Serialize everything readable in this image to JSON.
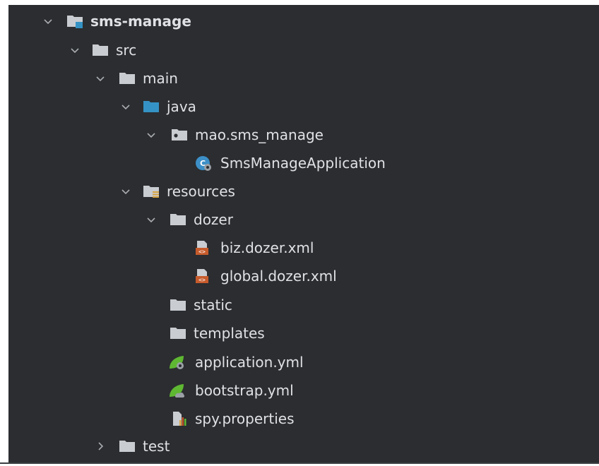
{
  "project_tree": {
    "root": {
      "label": "sms-manage"
    },
    "src": {
      "label": "src"
    },
    "main": {
      "label": "main"
    },
    "java": {
      "label": "java"
    },
    "package": {
      "label": "mao.sms_manage"
    },
    "app_class": {
      "label": "SmsManageApplication"
    },
    "resources": {
      "label": "resources"
    },
    "dozer": {
      "label": "dozer"
    },
    "biz_xml": {
      "label": "biz.dozer.xml"
    },
    "global_xml": {
      "label": "global.dozer.xml"
    },
    "static": {
      "label": "static"
    },
    "templates": {
      "label": "templates"
    },
    "application_yml": {
      "label": "application.yml"
    },
    "bootstrap_yml": {
      "label": "bootstrap.yml"
    },
    "spy_properties": {
      "label": "spy.properties"
    },
    "test": {
      "label": "test"
    }
  },
  "colors": {
    "background": "#2b2d30",
    "text": "#dfe1e5",
    "folder": "#c9ccd1",
    "source_folder": "#3592c4",
    "spring_green": "#5fb832",
    "xml_orange": "#c75b2c"
  }
}
